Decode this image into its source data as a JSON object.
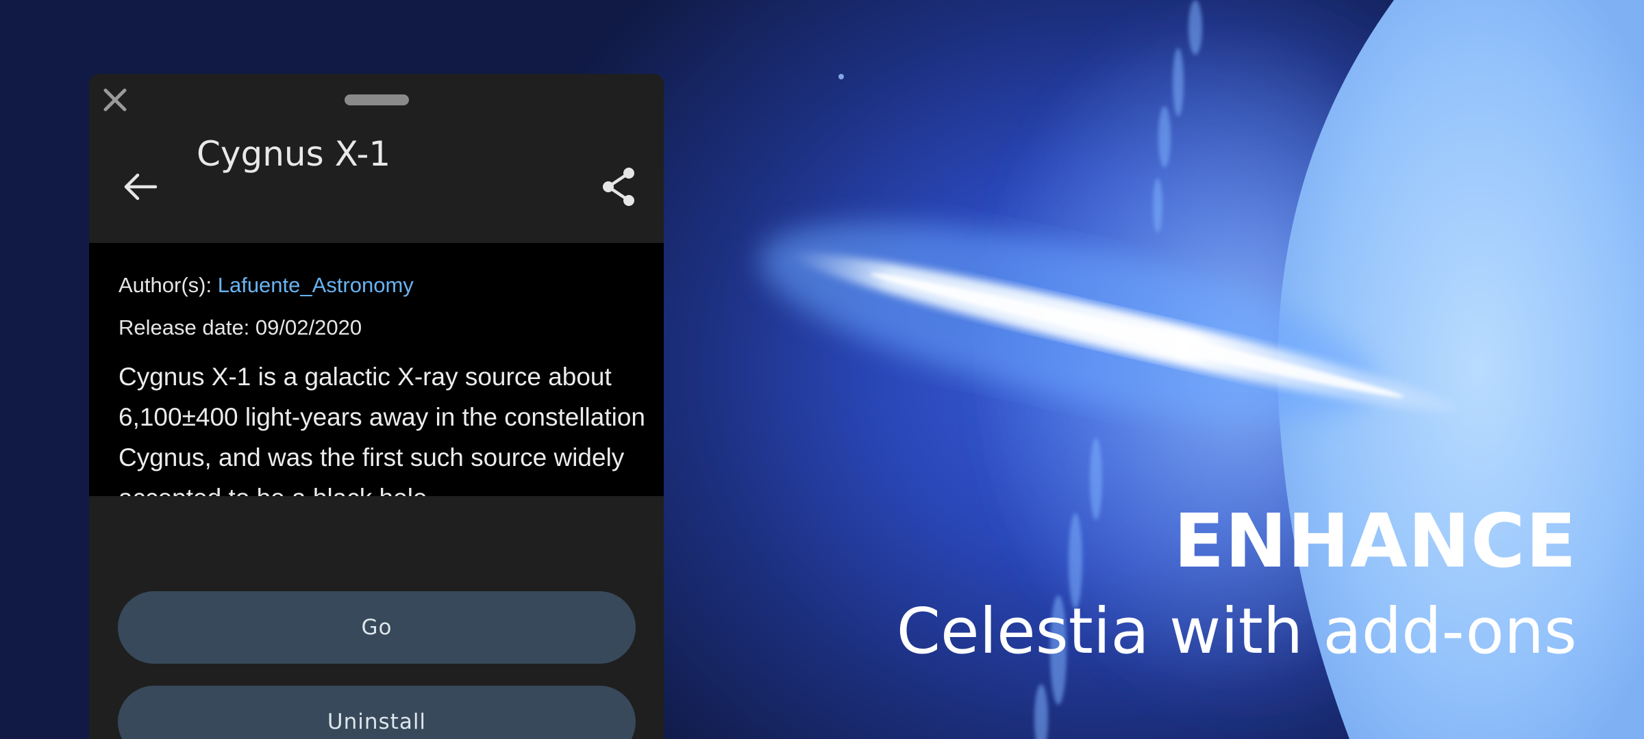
{
  "panel": {
    "title": "Cygnus X-1",
    "author_label": "Author(s): ",
    "author_name": "Lafuente_Astronomy",
    "release_date_text": "Release date: 09/02/2020",
    "description": "Cygnus X-1 is a galactic X-ray source about 6,100±400 light-years away in the constellation Cygnus, and was the first such source widely accepted to be a black hole",
    "actions": {
      "go_label": "Go",
      "uninstall_label": "Uninstall"
    },
    "icons": {
      "close": "close-icon",
      "handle": "drag-handle",
      "back": "arrow-left-icon",
      "share": "share-icon"
    }
  },
  "promo": {
    "headline": "ENHANCE",
    "subline": "Celestia with add-ons"
  },
  "colors": {
    "panel_bg": "#1f1f1f",
    "content_bg": "#000000",
    "button_bg": "#37495a",
    "link": "#6ab3f2",
    "space_blue": "#2a47b8"
  }
}
